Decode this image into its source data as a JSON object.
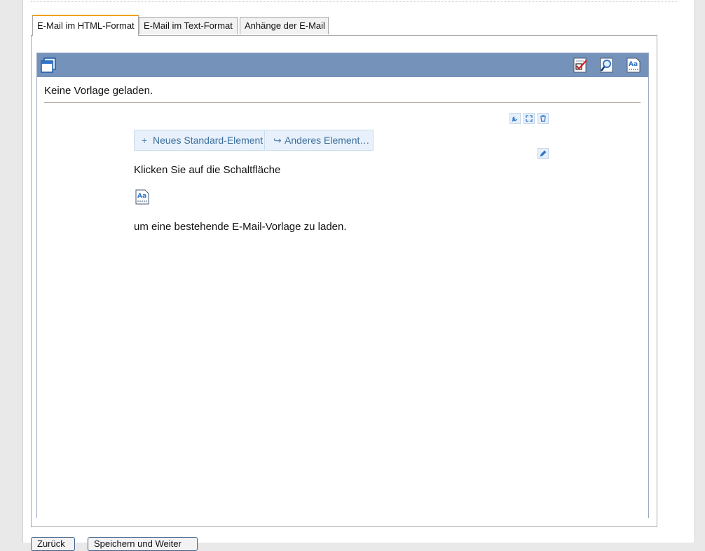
{
  "tabs": [
    {
      "label": "E-Mail im HTML-Format",
      "active": true
    },
    {
      "label": "E-Mail im Text-Format",
      "active": false
    },
    {
      "label": "Anhänge der E-Mail",
      "active": false
    }
  ],
  "editor": {
    "toolbar_icons": [
      "window-icon",
      "checklist-icon",
      "preview-icon",
      "template-icon"
    ],
    "status": "Keine Vorlage geladen.",
    "element_buttons": {
      "new_standard": "Neues Standard-Element",
      "other_element": "Anderes Element…"
    },
    "element_icons": [
      "wrench-icon",
      "expand-icon",
      "trash-icon",
      "pencil-icon"
    ],
    "hint_line_1": "Klicken Sie auf die Schaltfläche",
    "hint_icon": "template-icon",
    "hint_line_2": "um eine bestehende E-Mail-Vorlage zu laden."
  },
  "footer": {
    "back_label": "Zurück",
    "save_next_label": "Speichern und Weiter"
  },
  "colors": {
    "toolbar_bg": "#7592ba",
    "active_tab_accent": "#f0a000",
    "element_button_text": "#3c6e9e",
    "element_button_bg": "#e8f1fb"
  }
}
